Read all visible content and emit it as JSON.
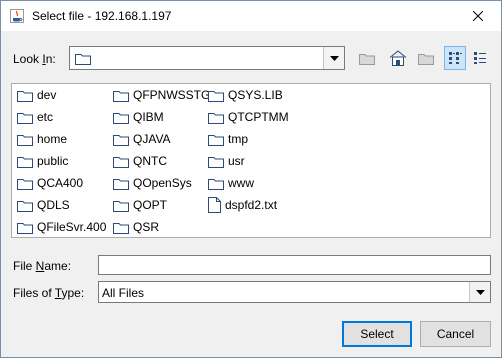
{
  "window": {
    "title": "Select file - 192.168.1.197"
  },
  "look_in": {
    "label_prefix": "Look ",
    "label_mnemonic": "I",
    "label_suffix": "n:",
    "value": ""
  },
  "toolbar": {
    "up_one_level": "up-folder-icon",
    "home": "home-icon",
    "new_folder": "new-folder-icon",
    "list_view": "list-view-icon",
    "details_view": "details-view-icon"
  },
  "files": [
    {
      "name": "dev",
      "type": "folder"
    },
    {
      "name": "etc",
      "type": "folder"
    },
    {
      "name": "home",
      "type": "folder"
    },
    {
      "name": "public",
      "type": "folder"
    },
    {
      "name": "QCA400",
      "type": "folder"
    },
    {
      "name": "QDLS",
      "type": "folder"
    },
    {
      "name": "QFileSvr.400",
      "type": "folder"
    },
    {
      "name": "QFPNWSSTG",
      "type": "folder"
    },
    {
      "name": "QIBM",
      "type": "folder"
    },
    {
      "name": "QJAVA",
      "type": "folder"
    },
    {
      "name": "QNTC",
      "type": "folder"
    },
    {
      "name": "QOpenSys",
      "type": "folder"
    },
    {
      "name": "QOPT",
      "type": "folder"
    },
    {
      "name": "QSR",
      "type": "folder"
    },
    {
      "name": "QSYS.LIB",
      "type": "folder"
    },
    {
      "name": "QTCPTMM",
      "type": "folder"
    },
    {
      "name": "tmp",
      "type": "folder"
    },
    {
      "name": "usr",
      "type": "folder"
    },
    {
      "name": "www",
      "type": "folder"
    },
    {
      "name": "dspfd2.txt",
      "type": "file"
    }
  ],
  "file_name": {
    "label_prefix": "File ",
    "label_mnemonic": "N",
    "label_suffix": "ame:",
    "value": ""
  },
  "file_type": {
    "label_prefix": "Files of ",
    "label_mnemonic": "T",
    "label_suffix": "ype:",
    "value": "All Files"
  },
  "buttons": {
    "select": "Select",
    "cancel": "Cancel"
  }
}
